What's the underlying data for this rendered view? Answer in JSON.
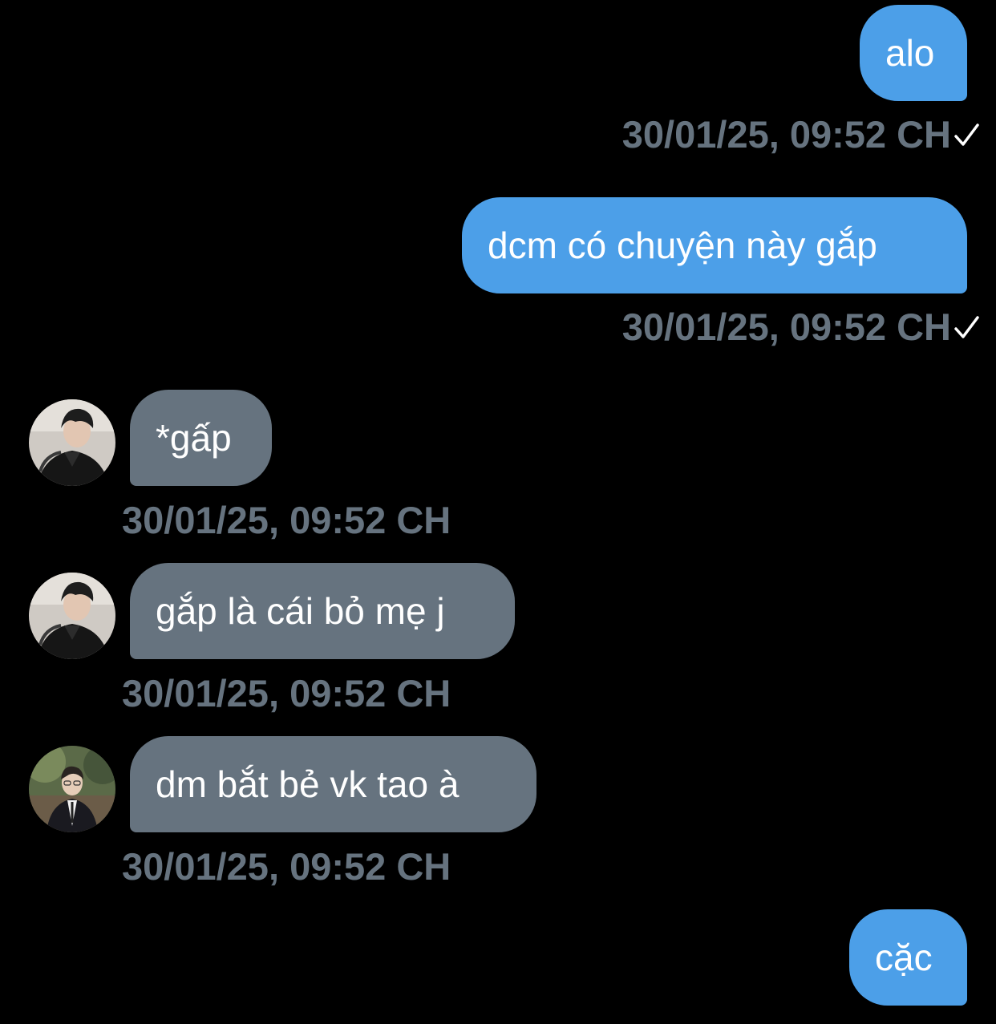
{
  "messages": [
    {
      "direction": "outgoing",
      "text": "alo",
      "time": "30/01/25, 09:52 CH",
      "status_icon": "checkmark-icon"
    },
    {
      "direction": "outgoing",
      "text": "dcm có chuyện này gắp",
      "time": "30/01/25, 09:52 CH",
      "status_icon": "checkmark-icon"
    },
    {
      "direction": "incoming",
      "text": "*gấp",
      "time": "30/01/25, 09:52 CH",
      "avatar": "avatar-photo"
    },
    {
      "direction": "incoming",
      "text": "gắp là cái bỏ mẹ j",
      "time": "30/01/25, 09:52 CH",
      "avatar": "avatar-photo"
    },
    {
      "direction": "incoming",
      "text": "dm bắt bẻ vk tao à",
      "time": "30/01/25, 09:52 CH",
      "avatar": "avatar-photo"
    },
    {
      "direction": "outgoing",
      "text": "cặc"
    }
  ],
  "colors": {
    "background": "#000000",
    "outgoing_bubble": "#4c9fe8",
    "incoming_bubble": "#66737f",
    "timestamp": "#66737f",
    "checkmark": "#ffffff"
  }
}
